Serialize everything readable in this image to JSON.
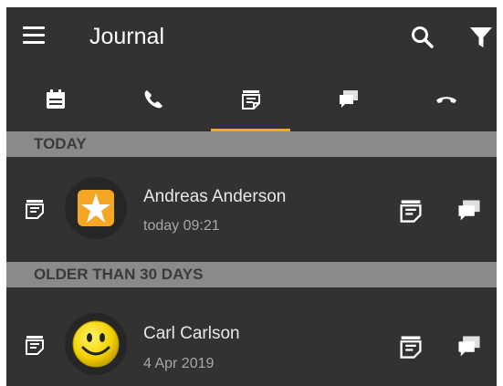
{
  "appbar": {
    "title": "Journal",
    "menu_icon": "menu-icon",
    "search_icon": "search-icon",
    "filter_icon": "filter-icon"
  },
  "tabs": [
    {
      "icon": "calendar-icon",
      "selected": false
    },
    {
      "icon": "phone-icon",
      "selected": false
    },
    {
      "icon": "notes-icon",
      "selected": true
    },
    {
      "icon": "chat-icon",
      "selected": false
    },
    {
      "icon": "hangup-icon",
      "selected": false
    }
  ],
  "sections": [
    {
      "header": "TODAY",
      "entries": [
        {
          "name": "Andreas Anderson",
          "time": "today 09:21",
          "avatar": "star-app-icon"
        }
      ]
    },
    {
      "header": "OLDER THAN 30 DAYS",
      "entries": [
        {
          "name": "Carl Carlson",
          "time": "4 Apr 2019",
          "avatar": "smiley-face-icon"
        }
      ]
    }
  ],
  "colors": {
    "background": "#323232",
    "section_header": "#8a8a8a",
    "accent": "#f5a623",
    "icon": "#ffffff"
  }
}
